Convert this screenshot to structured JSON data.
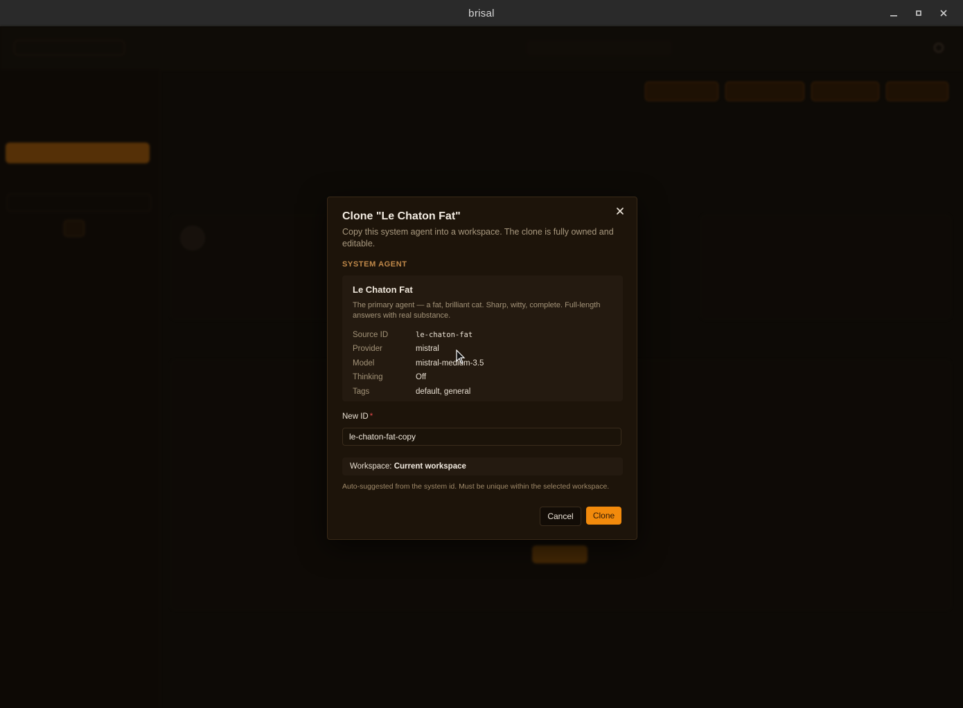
{
  "window": {
    "title": "brisal"
  },
  "dialog": {
    "title": "Clone \"Le Chaton Fat\"",
    "description": "Copy this system agent into a workspace. The clone is fully owned and editable.",
    "section_label": "SYSTEM AGENT",
    "agent": {
      "name": "Le Chaton Fat",
      "description": "The primary agent — a fat, brilliant cat. Sharp, witty, complete. Full-length answers with real substance.",
      "fields": [
        {
          "label": "Source ID",
          "value": "le-chaton-fat"
        },
        {
          "label": "Provider",
          "value": "mistral"
        },
        {
          "label": "Model",
          "value": "mistral-medium-3.5"
        },
        {
          "label": "Thinking",
          "value": "Off"
        },
        {
          "label": "Tags",
          "value": "default, general"
        }
      ]
    },
    "new_id": {
      "label": "New ID",
      "required_mark": "*",
      "value": "le-chaton-fat-copy"
    },
    "workspace": {
      "prefix": "Workspace:",
      "value": "Current workspace"
    },
    "hint": "Auto-suggested from the system id. Must be unique within the selected workspace.",
    "cancel_label": "Cancel",
    "clone_label": "Clone",
    "close_icon": "close-icon"
  },
  "colors": {
    "accent": "#f28a0c",
    "background": "#141009",
    "dialog_bg": "#1d140a",
    "section_label": "#c28a4a",
    "required": "#e04848"
  }
}
